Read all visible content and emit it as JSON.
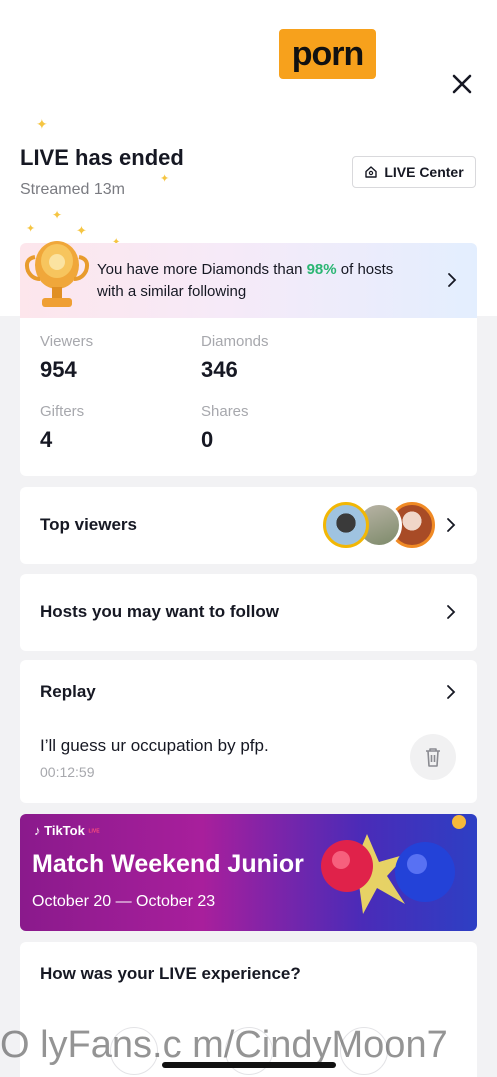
{
  "header": {
    "logo_text": "porn",
    "close_icon": "close-icon"
  },
  "summary": {
    "title": "LIVE has ended",
    "streamed": "Streamed  13m",
    "live_center_label": "LIVE Center",
    "live_center_icon": "home-icon"
  },
  "banner": {
    "text_before": "You have more Diamonds than ",
    "percent": "98%",
    "text_after": " of hosts with a similar following",
    "icon": "trophy-icon",
    "accent_color": "#2bb673"
  },
  "stats": [
    {
      "label": "Viewers",
      "value": "954"
    },
    {
      "label": "Diamonds",
      "value": "346"
    },
    {
      "label": "Gifters",
      "value": "4"
    },
    {
      "label": "Shares",
      "value": "0"
    }
  ],
  "top_viewers": {
    "label": "Top viewers"
  },
  "hosts": {
    "label": "Hosts you may want to follow"
  },
  "replay": {
    "title": "Replay",
    "item_title": "I’ll guess ur occupation by pfp.",
    "item_time": "00:12:59",
    "delete_icon": "trash-icon"
  },
  "promo": {
    "brand": "TikTok",
    "brand_tag": "LIVE",
    "title": "Match Weekend Junior",
    "dates": "October 20 — October 23"
  },
  "experience": {
    "question": "How was your LIVE experience?"
  },
  "watermark": "O lyFans.c m/CindyMoon7"
}
